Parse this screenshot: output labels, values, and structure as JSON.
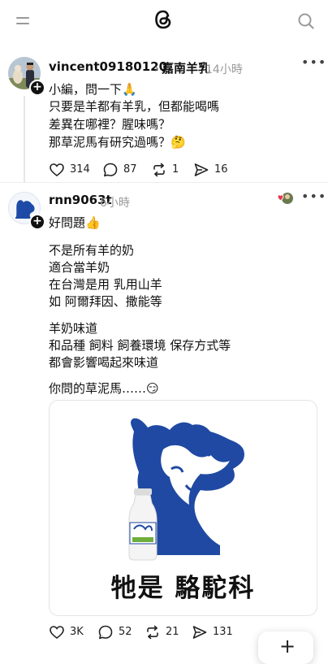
{
  "header": {
    "menu_icon": "menu-icon",
    "logo_icon": "threads-logo-icon",
    "search_icon": "search-icon"
  },
  "post": {
    "username": "vincent09180120",
    "tag": "嘉南羊乳",
    "time": "14小時",
    "lines": [
      "小編，問一下🙏",
      "只要是羊都有羊乳，但都能喝嗎",
      "差異在哪裡？腥味嗎？",
      "那草泥馬有研究過嗎？🤔"
    ],
    "likes": "314",
    "replies": "87",
    "reposts": "1",
    "shares": "16"
  },
  "reply": {
    "username": "rnn9063t",
    "time": "6小時",
    "lines": [
      "好問題👍",
      "不是所有羊的奶",
      "適合當羊奶",
      "在台灣是用  乳用山羊",
      "如  阿爾拜因、撒能等",
      "羊奶味道",
      "和品種  飼料 飼養環境  保存方式等",
      "都會影響喝起來味道",
      "你問的草泥馬……😏"
    ],
    "image_caption": "牠是  駱駝科",
    "likes": "3K",
    "replies": "52",
    "reposts": "21",
    "shares": "131"
  },
  "fab_label": "+"
}
